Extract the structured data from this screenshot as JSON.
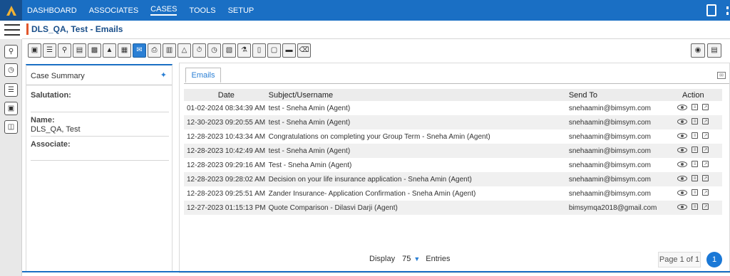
{
  "nav": {
    "items": [
      "DASHBOARD",
      "ASSOCIATES",
      "CASES",
      "TOOLS",
      "SETUP"
    ],
    "active_index": 2
  },
  "header": {
    "title": "DLS_QA, Test - Emails"
  },
  "colors": {
    "nav_bg": "#1a6fc4",
    "accent": "#e2572c",
    "link": "#2a7fd4"
  },
  "toolbar": {
    "icons": [
      "summary-icon",
      "applicant-icon",
      "search-doc-icon",
      "notes-icon",
      "document-icon",
      "attach-icon",
      "message-icon",
      "email-icon",
      "print-icon",
      "form-icon",
      "bell-icon",
      "timer-icon",
      "clock-icon",
      "drive-icon",
      "users-icon",
      "tablet-icon",
      "gallery-icon",
      "copy-icon",
      "trash-icon"
    ],
    "right_icons": [
      "upload-icon",
      "share-icon"
    ]
  },
  "summary": {
    "title": "Case Summary",
    "fields": [
      {
        "label": "Salutation:",
        "value": ""
      },
      {
        "label": "Name:",
        "value": "DLS_QA, Test"
      },
      {
        "label": "Associate:",
        "value": ""
      }
    ]
  },
  "emails": {
    "tab_label": "Emails",
    "columns": [
      "Date",
      "Subject/Username",
      "Send To",
      "Action"
    ],
    "rows": [
      {
        "date": "01-02-2024 08:34:39 AM",
        "subject": "test - Sneha Amin (Agent)",
        "to": "snehaamin@bimsym.com"
      },
      {
        "date": "12-30-2023 09:20:55 AM",
        "subject": "test - Sneha Amin (Agent)",
        "to": "snehaamin@bimsym.com"
      },
      {
        "date": "12-28-2023 10:43:34 AM",
        "subject": "Congratulations on completing your Group Term - Sneha Amin (Agent)",
        "to": "snehaamin@bimsym.com"
      },
      {
        "date": "12-28-2023 10:42:49 AM",
        "subject": "test - Sneha Amin (Agent)",
        "to": "snehaamin@bimsym.com"
      },
      {
        "date": "12-28-2023 09:29:16 AM",
        "subject": "Test - Sneha Amin (Agent)",
        "to": "snehaamin@bimsym.com"
      },
      {
        "date": "12-28-2023 09:28:02 AM",
        "subject": "Decision on your life insurance application - Sneha Amin (Agent)",
        "to": "snehaamin@bimsym.com"
      },
      {
        "date": "12-28-2023 09:25:51 AM",
        "subject": "Zander Insurance- Application Confirmation - Sneha Amin (Agent)",
        "to": "snehaamin@bimsym.com"
      },
      {
        "date": "12-27-2023 01:15:13 PM",
        "subject": "Quote Comparison - Dilasvi Darji (Agent)",
        "to": "bimsymqa2018@gmail.com"
      }
    ]
  },
  "pager": {
    "display_label": "Display",
    "page_size": "75",
    "entries_label": "Entries",
    "page_of": "Page 1 of 1",
    "current_page": "1"
  }
}
